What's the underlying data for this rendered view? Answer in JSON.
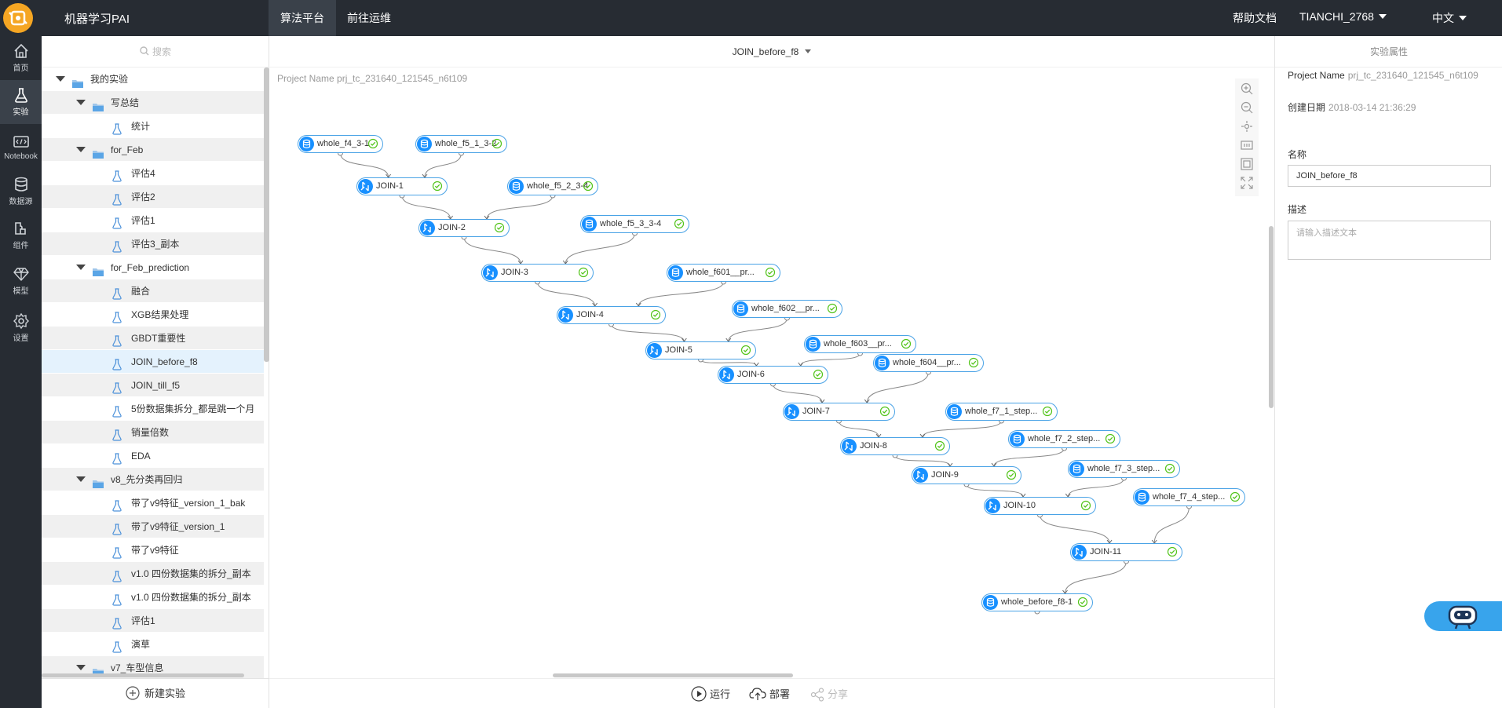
{
  "app": {
    "title": "机器学习PAI"
  },
  "topnav": {
    "algo": "算法平台",
    "ops": "前往运维",
    "help": "帮助文档",
    "user": "TIANCHI_2768",
    "lang": "中文"
  },
  "rail": [
    {
      "label": "首页",
      "icon": "home-icon"
    },
    {
      "label": "实验",
      "icon": "flask-icon"
    },
    {
      "label": "Notebook",
      "icon": "notebook-icon"
    },
    {
      "label": "数据源",
      "icon": "database-icon"
    },
    {
      "label": "组件",
      "icon": "component-icon"
    },
    {
      "label": "模型",
      "icon": "diamond-icon"
    },
    {
      "label": "设置",
      "icon": "gear-icon"
    }
  ],
  "tree": {
    "search_placeholder": "搜索",
    "items": [
      {
        "label": "我的实验",
        "kind": "folder",
        "level": 0
      },
      {
        "label": "写总结",
        "kind": "folder",
        "level": 1
      },
      {
        "label": "统计",
        "kind": "exp",
        "level": 2
      },
      {
        "label": "for_Feb",
        "kind": "folder",
        "level": 1
      },
      {
        "label": "评估4",
        "kind": "exp",
        "level": 2
      },
      {
        "label": "评估2",
        "kind": "exp",
        "level": 2
      },
      {
        "label": "评估1",
        "kind": "exp",
        "level": 2
      },
      {
        "label": "评估3_副本",
        "kind": "exp",
        "level": 2
      },
      {
        "label": "for_Feb_prediction",
        "kind": "folder",
        "level": 1
      },
      {
        "label": "融合",
        "kind": "exp",
        "level": 2
      },
      {
        "label": "XGB结果处理",
        "kind": "exp",
        "level": 2
      },
      {
        "label": "GBDT重要性",
        "kind": "exp",
        "level": 2
      },
      {
        "label": "JOIN_before_f8",
        "kind": "exp",
        "level": 2,
        "selected": true
      },
      {
        "label": "JOIN_till_f5",
        "kind": "exp",
        "level": 2
      },
      {
        "label": "5份数据集拆分_都是跳一个月",
        "kind": "exp",
        "level": 2
      },
      {
        "label": "销量倍数",
        "kind": "exp",
        "level": 2
      },
      {
        "label": "EDA",
        "kind": "exp",
        "level": 2
      },
      {
        "label": "v8_先分类再回归",
        "kind": "folder",
        "level": 1
      },
      {
        "label": "带了v9特征_version_1_bak",
        "kind": "exp",
        "level": 2
      },
      {
        "label": "带了v9特征_version_1",
        "kind": "exp",
        "level": 2
      },
      {
        "label": "带了v9特征",
        "kind": "exp",
        "level": 2
      },
      {
        "label": "v1.0 四份数据集的拆分_副本",
        "kind": "exp",
        "level": 2
      },
      {
        "label": "v1.0 四份数据集的拆分_副本",
        "kind": "exp",
        "level": 2
      },
      {
        "label": "评估1",
        "kind": "exp",
        "level": 2
      },
      {
        "label": "演草",
        "kind": "exp",
        "level": 2
      },
      {
        "label": "v7_车型信息",
        "kind": "folder",
        "level": 1
      }
    ],
    "new_experiment": "新建实验"
  },
  "canvas": {
    "experiment_title": "JOIN_before_f8",
    "project_label": "Project Name",
    "project_value": "prj_tc_231640_121545_n6t109",
    "nodes": [
      {
        "id": "n1",
        "label": "whole_f4_3-1",
        "type": "data"
      },
      {
        "id": "n2",
        "label": "whole_f5_1_3-2",
        "type": "data"
      },
      {
        "id": "n3",
        "label": "JOIN-1",
        "type": "join"
      },
      {
        "id": "n4",
        "label": "whole_f5_2_3-4",
        "type": "data"
      },
      {
        "id": "n5",
        "label": "JOIN-2",
        "type": "join"
      },
      {
        "id": "n6",
        "label": "whole_f5_3_3-4",
        "type": "data"
      },
      {
        "id": "n7",
        "label": "JOIN-3",
        "type": "join"
      },
      {
        "id": "n8",
        "label": "whole_f601__pr...",
        "type": "data"
      },
      {
        "id": "n9",
        "label": "JOIN-4",
        "type": "join"
      },
      {
        "id": "n10",
        "label": "whole_f602__pr...",
        "type": "data"
      },
      {
        "id": "n11",
        "label": "JOIN-5",
        "type": "join"
      },
      {
        "id": "n12",
        "label": "whole_f603__pr...",
        "type": "data"
      },
      {
        "id": "n13",
        "label": "JOIN-6",
        "type": "join"
      },
      {
        "id": "n14",
        "label": "whole_f604__pr...",
        "type": "data"
      },
      {
        "id": "n15",
        "label": "JOIN-7",
        "type": "join"
      },
      {
        "id": "n16",
        "label": "whole_f7_1_step...",
        "type": "data"
      },
      {
        "id": "n17",
        "label": "JOIN-8",
        "type": "join"
      },
      {
        "id": "n18",
        "label": "whole_f7_2_step...",
        "type": "data"
      },
      {
        "id": "n19",
        "label": "JOIN-9",
        "type": "join"
      },
      {
        "id": "n20",
        "label": "whole_f7_3_step...",
        "type": "data"
      },
      {
        "id": "n21",
        "label": "JOIN-10",
        "type": "join"
      },
      {
        "id": "n22",
        "label": "whole_f7_4_step...",
        "type": "data"
      },
      {
        "id": "n23",
        "label": "JOIN-11",
        "type": "join"
      },
      {
        "id": "n24",
        "label": "whole_before_f8-1",
        "type": "data"
      }
    ],
    "edges": [
      [
        "n1",
        "n3"
      ],
      [
        "n2",
        "n3"
      ],
      [
        "n3",
        "n5"
      ],
      [
        "n4",
        "n5"
      ],
      [
        "n5",
        "n7"
      ],
      [
        "n6",
        "n7"
      ],
      [
        "n7",
        "n9"
      ],
      [
        "n8",
        "n9"
      ],
      [
        "n9",
        "n11"
      ],
      [
        "n10",
        "n11"
      ],
      [
        "n11",
        "n13"
      ],
      [
        "n12",
        "n13"
      ],
      [
        "n13",
        "n15"
      ],
      [
        "n14",
        "n15"
      ],
      [
        "n15",
        "n17"
      ],
      [
        "n16",
        "n17"
      ],
      [
        "n17",
        "n19"
      ],
      [
        "n18",
        "n19"
      ],
      [
        "n19",
        "n21"
      ],
      [
        "n20",
        "n21"
      ],
      [
        "n21",
        "n23"
      ],
      [
        "n22",
        "n23"
      ],
      [
        "n23",
        "n24"
      ]
    ],
    "toolbar": {
      "run": "运行",
      "deploy": "部署",
      "share": "分享"
    }
  },
  "props": {
    "title": "实验属性",
    "project_label": "Project Name",
    "project_value": "prj_tc_231640_121545_n6t109",
    "created_label": "创建日期",
    "created_value": "2018-03-14 21:36:29",
    "name_label": "名称",
    "name_value": "JOIN_before_f8",
    "desc_label": "描述",
    "desc_placeholder": "请输入描述文本"
  },
  "colors": {
    "accent": "#1890ff",
    "topbar": "#272c33",
    "node_border": "#4aa3e6",
    "ok": "#52c41a"
  }
}
